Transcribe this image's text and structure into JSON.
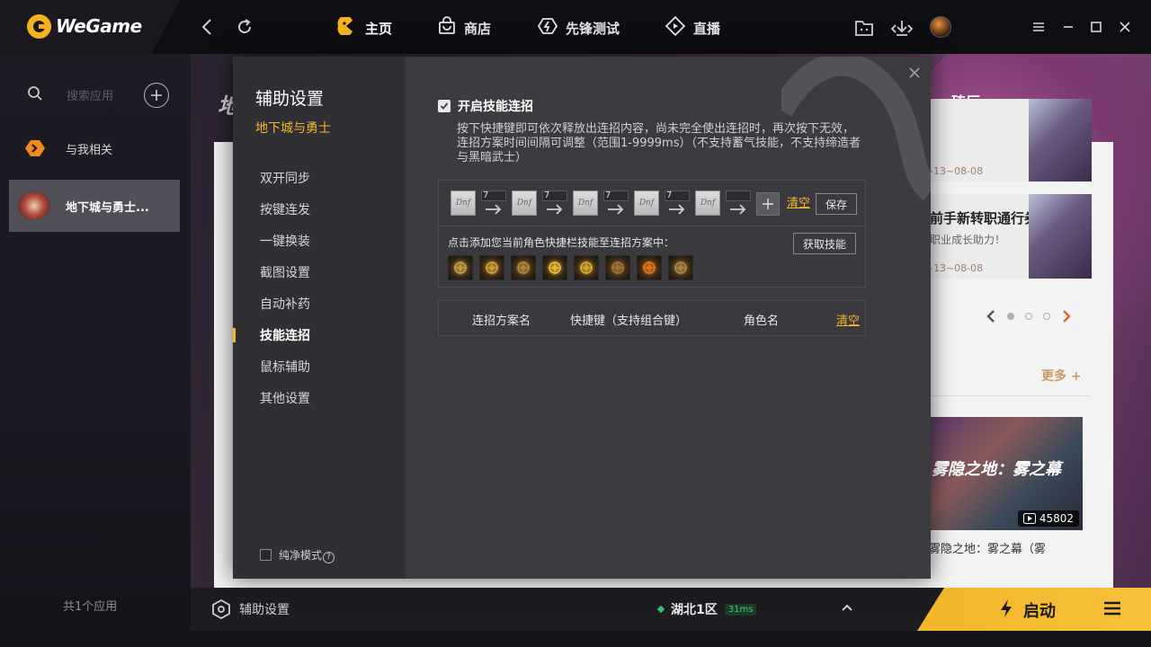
{
  "app": {
    "logo_text": "WeGame"
  },
  "nav": {
    "home": "主页",
    "store": "商店",
    "pioneer": "先锋测试",
    "live": "直播"
  },
  "sidebar": {
    "search_placeholder": "搜索应用",
    "items": [
      {
        "label": "与我相关"
      },
      {
        "label": "地下城与勇士..."
      }
    ],
    "count_text": "共1个应用"
  },
  "background": {
    "left_text": "地",
    "right_text": "砖厂",
    "cards": [
      {
        "title": "",
        "sub": "",
        "date": "-13~08-08"
      },
      {
        "title": "前手新转职通行券",
        "sub": "职业成长助力！",
        "date": "-13~08-08"
      }
    ],
    "more": "更多",
    "video_title": "雾隐之地：雾之幕",
    "video_count": "45802",
    "video_caption": "】雾隐之地：雾之幕（雾"
  },
  "modal": {
    "title": "辅助设置",
    "game": "地下城与勇士",
    "menu": [
      "双开同步",
      "按键连发",
      "一键换装",
      "截图设置",
      "自动补药",
      "技能连招",
      "鼠标辅助",
      "其他设置"
    ],
    "active_menu": "技能连招",
    "pure_mode": "纯净模式",
    "help_glyph": "?",
    "enable_label": "开启技能连招",
    "description": "按下快捷键即可依次释放出连招内容，尚未完全使出连招时，再次按下无效，连招方案时间间隔可调整（范围1-9999ms）（不支持蓄气技能，不支持缔造者与黑暗武士）",
    "slot_text": "Dnf",
    "intervals": [
      "7",
      "7",
      "7",
      "7",
      ""
    ],
    "clear_label": "清空",
    "save_label": "保存",
    "tip": "点击添加您当前角色快捷栏技能至连招方案中：",
    "fetch_label": "获取技能",
    "skill_icons": [
      {
        "name": "skill-icon-1",
        "color": "#c9a24a"
      },
      {
        "name": "skill-icon-2",
        "color": "#d4a63a"
      },
      {
        "name": "skill-icon-3",
        "color": "#b88a3a"
      },
      {
        "name": "skill-icon-4",
        "color": "#f0c040"
      },
      {
        "name": "skill-icon-5",
        "color": "#e0b030"
      },
      {
        "name": "skill-icon-6",
        "color": "#a87a3a"
      },
      {
        "name": "skill-icon-7",
        "color": "#e87a20"
      },
      {
        "name": "skill-icon-8",
        "color": "#b08a4a"
      }
    ],
    "table": {
      "col_name": "连招方案名",
      "col_hotkey": "快捷键（支持组合键）",
      "col_role": "角色名",
      "clear_label": "清空"
    }
  },
  "bottombar": {
    "settings": "辅助设置",
    "server": "湖北1区",
    "ping": "31ms",
    "launch": "启动"
  },
  "colors": {
    "accent": "#f3b529",
    "launch": "#f5bc30",
    "ping": "#35c46a"
  }
}
